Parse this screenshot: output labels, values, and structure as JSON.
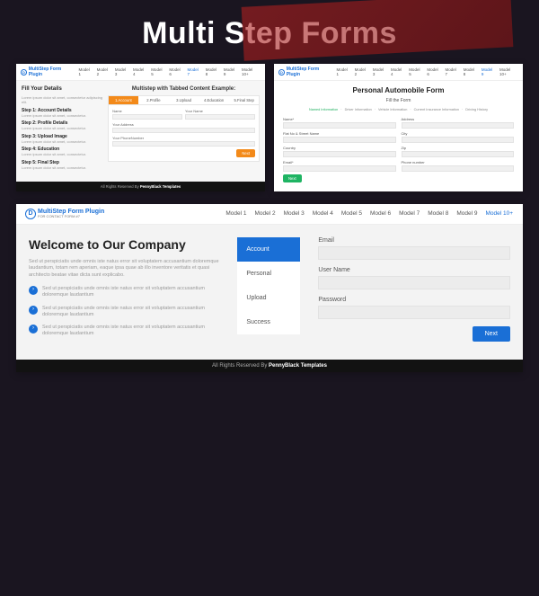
{
  "page_title": "Multi Step Forms",
  "footer_prefix": "All Rights Reserved By ",
  "footer_brand": "PennyBlack Templates",
  "nav_models": [
    "Model 1",
    "Model 2",
    "Model 3",
    "Model 4",
    "Model 5",
    "Model 6",
    "Model 7",
    "Model 8",
    "Model 9",
    "Model 10+"
  ],
  "brand_name": "MultiStep Form Plugin",
  "brand_sub": "FOR CONTACT FORM #7",
  "ss1": {
    "side_title": "Fill Your Details",
    "side_desc": "Lorem ipsum dolor sit amet, consectetur adipiscing elit.",
    "steps": [
      {
        "t": "Step 1: Account Details",
        "d": "Lorem ipsum dolor sit amet, consectetur."
      },
      {
        "t": "Step 2: Profile Details",
        "d": "Lorem ipsum dolor sit amet, consectetur."
      },
      {
        "t": "Step 3: Upload Image",
        "d": "Lorem ipsum dolor sit amet, consectetur."
      },
      {
        "t": "Step 4: Education",
        "d": "Lorem ipsum dolor sit amet, consectetur."
      },
      {
        "t": "Step 5: Final Step",
        "d": "Lorem ipsum dolor sit amet, consectetur."
      }
    ],
    "main_title": "Multistep with Tabbed Content Example:",
    "tabs": [
      "1.Account",
      "2.Profile",
      "3.Upload",
      "4.Education",
      "5.Final Step"
    ],
    "fields": {
      "name": "Name",
      "your_name": "Your Name",
      "address": "Your Address",
      "phone": "Your PhoneNumber"
    },
    "next": "Next"
  },
  "ss2": {
    "title": "Personal Automobile Form",
    "subtitle": "Fill the Form",
    "tabs": [
      "Named Information",
      "Driver Information",
      "Vehicle Information",
      "Current Insurance Information",
      "Driving History"
    ],
    "labels": {
      "name": "Name*",
      "address": "Address",
      "flat": "Flat No & Street Name",
      "city": "City",
      "country": "Country",
      "zip": "Zip",
      "email": "Email*",
      "phone": "Phone number"
    },
    "next": "Next"
  },
  "ss3": {
    "heading": "Welcome to Our Company",
    "intro": "Sed ut perspiciatis unde omnis iste natus error sit voluptatem accusantium doloremque laudantium, totam rem aperiam, eaque ipsa quae ab illo inventore veritatis et quasi architecto beatae vitae dicta sunt explicabo.",
    "bullets": [
      "Sed ut perspiciatis unde omnis iste natus error sit voluptatem accusantium doloremque laudantium",
      "Sed ut perspiciatis unde omnis iste natus error sit voluptatem accusantium doloremque laudantium",
      "Sed ut perspiciatis unde omnis iste natus error sit voluptatem accusantium doloremque laudantium"
    ],
    "vtabs": [
      "Account",
      "Personal",
      "Upload",
      "Success"
    ],
    "labels": {
      "email": "Email",
      "username": "User Name",
      "password": "Password"
    },
    "next": "Next"
  }
}
